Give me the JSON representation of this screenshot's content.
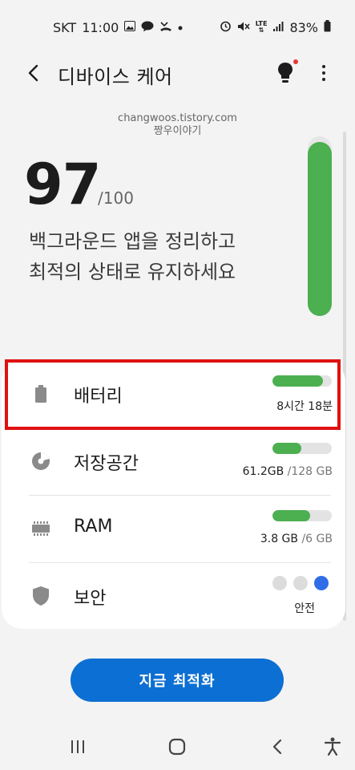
{
  "status_bar": {
    "carrier": "SKT",
    "time": "11:00",
    "left_icons": [
      "image-icon",
      "talk-icon",
      "missed-call-icon",
      "dot-icon"
    ],
    "right_icons": [
      "alarm-icon",
      "mute-icon",
      "lte-icon",
      "signal-icon"
    ],
    "lte_label": "LTE",
    "battery": "83%"
  },
  "app_bar": {
    "title": "디바이스 케어",
    "back_icon": "back-arrow-icon",
    "tips_icon": "lightbulb-icon",
    "more_icon": "more-vert-icon"
  },
  "watermark": {
    "line1": "changwoos.tistory.com",
    "line2": "짱우이야기"
  },
  "score": {
    "value": "97",
    "max": "/100",
    "fraction": 0.97,
    "message_line1": "백그라운드 앱을 정리하고",
    "message_line2": "최적의 상태로 유지하세요"
  },
  "items": [
    {
      "key": "battery",
      "label": "배터리",
      "icon": "battery-icon",
      "value": "8시간 18분",
      "sub": "",
      "level": 0.85
    },
    {
      "key": "storage",
      "label": "저장공간",
      "icon": "pie-chart-icon",
      "value": "61.2GB",
      "sub": " /128 GB",
      "level": 0.48
    },
    {
      "key": "ram",
      "label": "RAM",
      "icon": "memory-chip-icon",
      "value": "3.8 GB",
      "sub": " /6 GB",
      "level": 0.63
    },
    {
      "key": "security",
      "label": "보안",
      "icon": "shield-icon",
      "value": "안전",
      "sub": ""
    }
  ],
  "security_dots": [
    "#dcdcdc",
    "#dcdcdc",
    "#2f6ee8"
  ],
  "colors": {
    "accent": "#0c6fd3",
    "good": "#4caf50",
    "highlight": "#e01010"
  },
  "optimize_button": "지금 최적화",
  "nav_bar": {
    "icons": [
      "recent-apps-icon",
      "home-icon",
      "back-icon",
      "accessibility-icon"
    ]
  }
}
